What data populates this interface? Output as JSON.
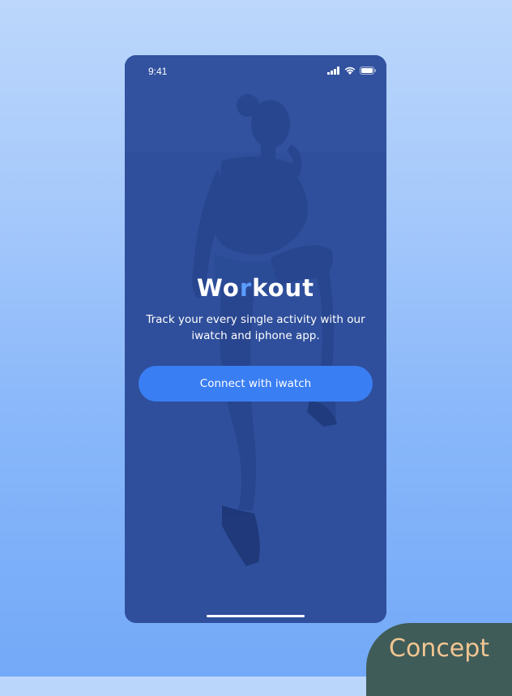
{
  "status_bar": {
    "time": "9:41"
  },
  "hero": {
    "title_part1": "Wo",
    "title_accent": "r",
    "title_part2": "kout",
    "subtitle": "Track your every single activity with our iwatch and iphone app."
  },
  "actions": {
    "connect_label": "Connect with iwatch"
  },
  "badge": {
    "label": "Concept"
  },
  "colors": {
    "phone_background": "#2e4d98",
    "accent": "#5b9cff",
    "button": "#3a7ef3",
    "badge_background": "#3f5c58",
    "badge_text": "#f2c592"
  },
  "icons": [
    "signal-icon",
    "wifi-icon",
    "battery-icon"
  ]
}
